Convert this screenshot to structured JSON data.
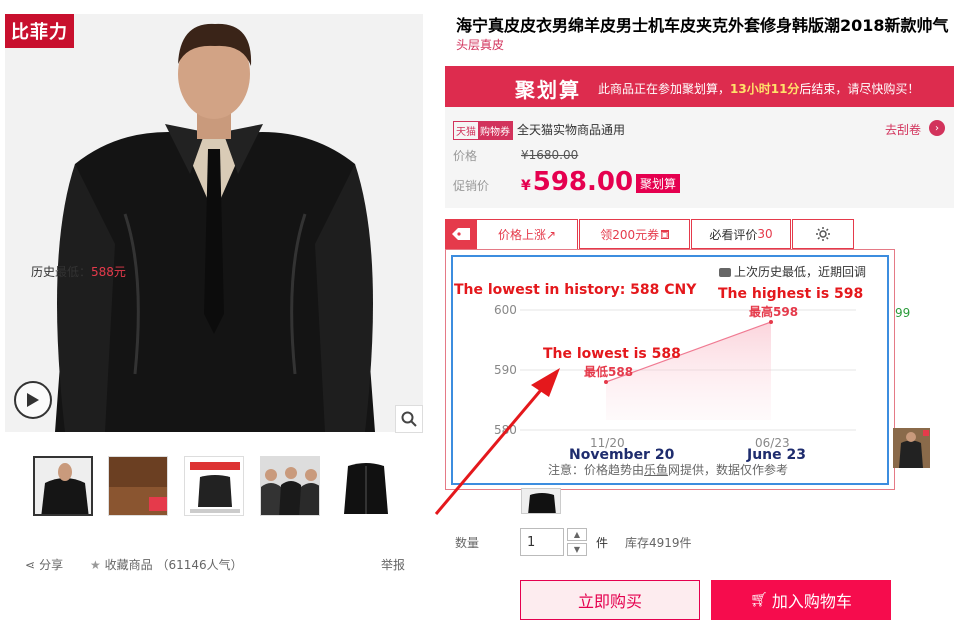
{
  "gallery": {
    "brand": "比菲力",
    "thumbnails": [
      "jacket-front",
      "leather-detail",
      "tag-label",
      "group-models",
      "jacket-black"
    ]
  },
  "actions": {
    "share": "分享",
    "favorite": "收藏商品",
    "popularity": "（61146人气）",
    "report": "举报"
  },
  "product": {
    "title": "海宁真皮皮衣男绵羊皮男士机车皮夹克外套修身韩版潮2018新款帅气",
    "subtitle": "头层真皮"
  },
  "juhuasuan": {
    "logo": "聚划算",
    "text_before": "此商品正在参加聚划算，",
    "time": "13小时11分",
    "text_after": "后结束，请尽快购买！"
  },
  "price_panel": {
    "tmall": "天猫",
    "coupon_tag": "购物券",
    "coupon_text": "全天猫实物商品通用",
    "coupon_link": "去刮卷",
    "orig_label": "价格",
    "orig_price": "¥1680.00",
    "promo_label": "促销价",
    "currency": "¥",
    "promo_price": "598.00",
    "promo_tag": "聚划算"
  },
  "plugin_tabs": {
    "price_up": "价格上涨↗",
    "coupon": "领200元券",
    "review_label": "必看评价",
    "review_count": "30"
  },
  "chart": {
    "hist_low_label": "历史最低：",
    "hist_low_value": "588元",
    "hist_note": "上次历史最低，近期回调",
    "footnote": "注意：价格趋势由",
    "footnote_link": "乐鱼",
    "footnote_after": "网提供，数据仅作参考",
    "low_point_label": "最低588",
    "high_point_label": "最高598"
  },
  "chart_data": {
    "type": "line",
    "x": [
      "11/20",
      "06/23"
    ],
    "series": [
      {
        "values": [
          588,
          598
        ]
      }
    ],
    "yticks": [
      600,
      590,
      580
    ],
    "ylim": [
      580,
      600
    ],
    "grid": true
  },
  "annotations": {
    "lowest_history": "The lowest in history: 588 CNY",
    "highest": "The highest is 598",
    "lowest": "The lowest is 588",
    "date_low": "November 20",
    "date_high": "June 23"
  },
  "side": {
    "green_text": "99"
  },
  "purchase": {
    "qty_label": "数量",
    "qty_value": "1",
    "unit": "件",
    "stock": "库存4919件",
    "buy_now": "立即购买",
    "add_cart": "加入购物车"
  },
  "colors": {
    "brand_red": "#dd2c4e",
    "price_red": "#e5004f",
    "chart_blue": "#3c8ddf"
  }
}
